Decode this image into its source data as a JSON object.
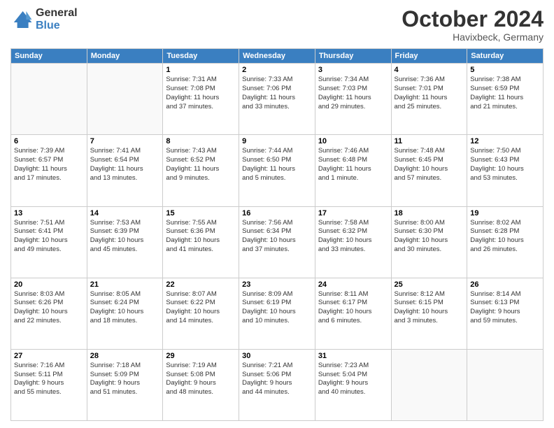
{
  "header": {
    "logo_line1": "General",
    "logo_line2": "Blue",
    "month_title": "October 2024",
    "location": "Havixbeck, Germany"
  },
  "weekdays": [
    "Sunday",
    "Monday",
    "Tuesday",
    "Wednesday",
    "Thursday",
    "Friday",
    "Saturday"
  ],
  "weeks": [
    [
      {
        "day": "",
        "info": ""
      },
      {
        "day": "",
        "info": ""
      },
      {
        "day": "1",
        "info": "Sunrise: 7:31 AM\nSunset: 7:08 PM\nDaylight: 11 hours\nand 37 minutes."
      },
      {
        "day": "2",
        "info": "Sunrise: 7:33 AM\nSunset: 7:06 PM\nDaylight: 11 hours\nand 33 minutes."
      },
      {
        "day": "3",
        "info": "Sunrise: 7:34 AM\nSunset: 7:03 PM\nDaylight: 11 hours\nand 29 minutes."
      },
      {
        "day": "4",
        "info": "Sunrise: 7:36 AM\nSunset: 7:01 PM\nDaylight: 11 hours\nand 25 minutes."
      },
      {
        "day": "5",
        "info": "Sunrise: 7:38 AM\nSunset: 6:59 PM\nDaylight: 11 hours\nand 21 minutes."
      }
    ],
    [
      {
        "day": "6",
        "info": "Sunrise: 7:39 AM\nSunset: 6:57 PM\nDaylight: 11 hours\nand 17 minutes."
      },
      {
        "day": "7",
        "info": "Sunrise: 7:41 AM\nSunset: 6:54 PM\nDaylight: 11 hours\nand 13 minutes."
      },
      {
        "day": "8",
        "info": "Sunrise: 7:43 AM\nSunset: 6:52 PM\nDaylight: 11 hours\nand 9 minutes."
      },
      {
        "day": "9",
        "info": "Sunrise: 7:44 AM\nSunset: 6:50 PM\nDaylight: 11 hours\nand 5 minutes."
      },
      {
        "day": "10",
        "info": "Sunrise: 7:46 AM\nSunset: 6:48 PM\nDaylight: 11 hours\nand 1 minute."
      },
      {
        "day": "11",
        "info": "Sunrise: 7:48 AM\nSunset: 6:45 PM\nDaylight: 10 hours\nand 57 minutes."
      },
      {
        "day": "12",
        "info": "Sunrise: 7:50 AM\nSunset: 6:43 PM\nDaylight: 10 hours\nand 53 minutes."
      }
    ],
    [
      {
        "day": "13",
        "info": "Sunrise: 7:51 AM\nSunset: 6:41 PM\nDaylight: 10 hours\nand 49 minutes."
      },
      {
        "day": "14",
        "info": "Sunrise: 7:53 AM\nSunset: 6:39 PM\nDaylight: 10 hours\nand 45 minutes."
      },
      {
        "day": "15",
        "info": "Sunrise: 7:55 AM\nSunset: 6:36 PM\nDaylight: 10 hours\nand 41 minutes."
      },
      {
        "day": "16",
        "info": "Sunrise: 7:56 AM\nSunset: 6:34 PM\nDaylight: 10 hours\nand 37 minutes."
      },
      {
        "day": "17",
        "info": "Sunrise: 7:58 AM\nSunset: 6:32 PM\nDaylight: 10 hours\nand 33 minutes."
      },
      {
        "day": "18",
        "info": "Sunrise: 8:00 AM\nSunset: 6:30 PM\nDaylight: 10 hours\nand 30 minutes."
      },
      {
        "day": "19",
        "info": "Sunrise: 8:02 AM\nSunset: 6:28 PM\nDaylight: 10 hours\nand 26 minutes."
      }
    ],
    [
      {
        "day": "20",
        "info": "Sunrise: 8:03 AM\nSunset: 6:26 PM\nDaylight: 10 hours\nand 22 minutes."
      },
      {
        "day": "21",
        "info": "Sunrise: 8:05 AM\nSunset: 6:24 PM\nDaylight: 10 hours\nand 18 minutes."
      },
      {
        "day": "22",
        "info": "Sunrise: 8:07 AM\nSunset: 6:22 PM\nDaylight: 10 hours\nand 14 minutes."
      },
      {
        "day": "23",
        "info": "Sunrise: 8:09 AM\nSunset: 6:19 PM\nDaylight: 10 hours\nand 10 minutes."
      },
      {
        "day": "24",
        "info": "Sunrise: 8:11 AM\nSunset: 6:17 PM\nDaylight: 10 hours\nand 6 minutes."
      },
      {
        "day": "25",
        "info": "Sunrise: 8:12 AM\nSunset: 6:15 PM\nDaylight: 10 hours\nand 3 minutes."
      },
      {
        "day": "26",
        "info": "Sunrise: 8:14 AM\nSunset: 6:13 PM\nDaylight: 9 hours\nand 59 minutes."
      }
    ],
    [
      {
        "day": "27",
        "info": "Sunrise: 7:16 AM\nSunset: 5:11 PM\nDaylight: 9 hours\nand 55 minutes."
      },
      {
        "day": "28",
        "info": "Sunrise: 7:18 AM\nSunset: 5:09 PM\nDaylight: 9 hours\nand 51 minutes."
      },
      {
        "day": "29",
        "info": "Sunrise: 7:19 AM\nSunset: 5:08 PM\nDaylight: 9 hours\nand 48 minutes."
      },
      {
        "day": "30",
        "info": "Sunrise: 7:21 AM\nSunset: 5:06 PM\nDaylight: 9 hours\nand 44 minutes."
      },
      {
        "day": "31",
        "info": "Sunrise: 7:23 AM\nSunset: 5:04 PM\nDaylight: 9 hours\nand 40 minutes."
      },
      {
        "day": "",
        "info": ""
      },
      {
        "day": "",
        "info": ""
      }
    ]
  ]
}
